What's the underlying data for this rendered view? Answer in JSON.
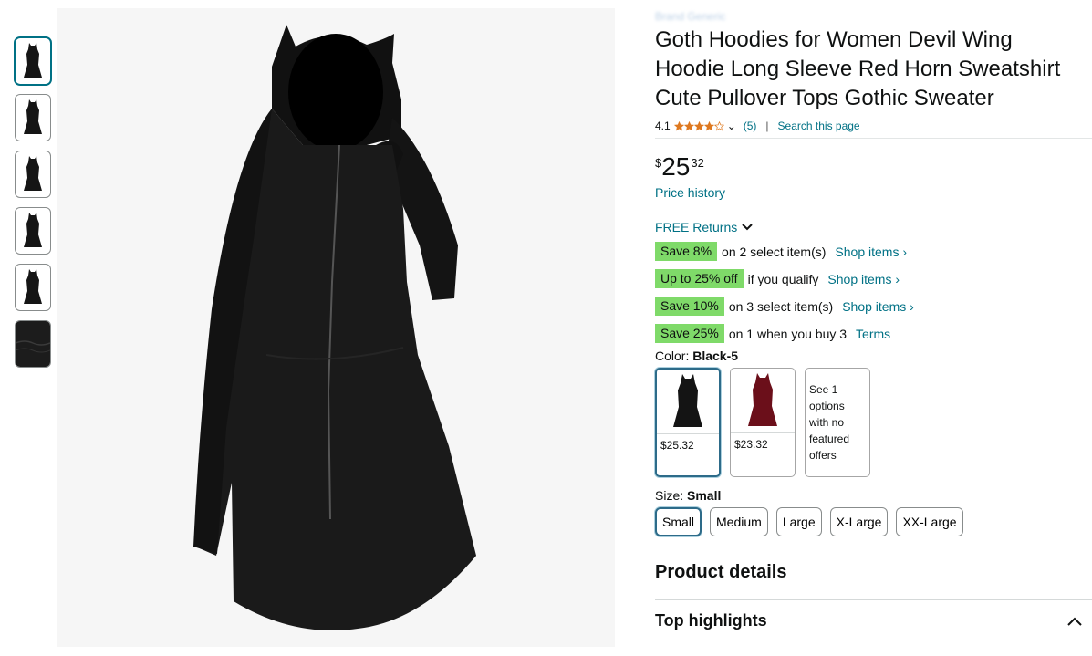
{
  "thumbnails": [
    "hoodie front",
    "hoodie front",
    "hoodie front",
    "hoodie front",
    "hoodie front",
    "fabric detail"
  ],
  "product": {
    "brand": "Brand Generic",
    "title": "Goth Hoodies for Women Devil Wing Hoodie Long Sleeve Red Horn Sweatshirt Cute Pullover Tops Gothic Sweater",
    "rating": "4.1",
    "rating_value": 4.1,
    "review_count": "(5)",
    "search_link": "Search this page",
    "pipe": "|",
    "price_symbol": "$",
    "price_whole": "25",
    "price_fraction": "32",
    "price_history": "Price history",
    "returns": "FREE Returns"
  },
  "promos": [
    {
      "badge": "Save 8%",
      "text": "on 2 select item(s)",
      "link": "Shop items ›"
    },
    {
      "badge": "Up to 25% off",
      "text": "if you qualify",
      "link": "Shop items ›"
    },
    {
      "badge": "Save 10%",
      "text": "on 3 select item(s)",
      "link": "Shop items ›"
    },
    {
      "badge": "Save 25%",
      "text": "on 1 when you buy 3",
      "link": "Terms"
    }
  ],
  "color": {
    "label": "Color: ",
    "selected": "Black-5",
    "options": [
      {
        "price": "$25.32",
        "swatch": "#1a1a1a"
      },
      {
        "price": "$23.32",
        "swatch": "#6b0f1a"
      }
    ],
    "more_text": "See 1 options with no featured offers"
  },
  "size": {
    "label": "Size: ",
    "selected": "Small",
    "options": [
      "Small",
      "Medium",
      "Large",
      "X-Large",
      "XX-Large"
    ]
  },
  "sections": {
    "product_details": "Product details",
    "top_highlights": "Top highlights"
  },
  "colors": {
    "link": "#007185",
    "badge_green": "#7fda69",
    "star": "#de7921",
    "selected_border": "#2d6b89"
  }
}
